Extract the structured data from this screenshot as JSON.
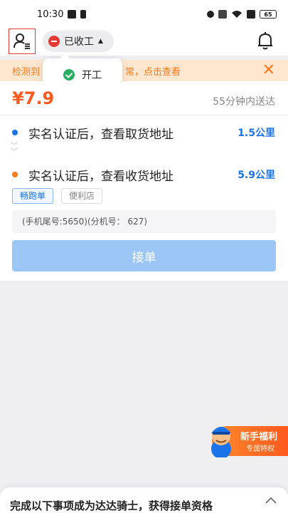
{
  "status_bar": {
    "time": "10:30",
    "battery": "65"
  },
  "header": {
    "work_status_label": "已收工",
    "popover_option_label": "开工"
  },
  "banner": {
    "text_left": "检测到",
    "text_right": "常，点击查看"
  },
  "order": {
    "price": "¥7.9",
    "eta": "55分钟内送达",
    "pickup": {
      "text": "实名认证后，查看取货地址",
      "distance": "1.5公里",
      "dot_color": "#1a73e8"
    },
    "dropoff": {
      "text": "实名认证后，查看收货地址",
      "distance": "5.9公里",
      "dot_color": "#ff7a1a"
    },
    "tags": [
      "畅跑单",
      "便利店"
    ],
    "phone_info": "(手机尾号:5650)(分机号： 627)",
    "accept_label": "接单"
  },
  "promo": {
    "title": "新手福利",
    "subtitle": "专属特权"
  },
  "bottom_sheet": {
    "text": "完成以下事项成为达达骑士，获得接单资格"
  },
  "icons": [
    "profile-icon",
    "bell-icon",
    "close-icon",
    "check-icon",
    "chevron-up-icon",
    "double-chevron-down-icon"
  ]
}
